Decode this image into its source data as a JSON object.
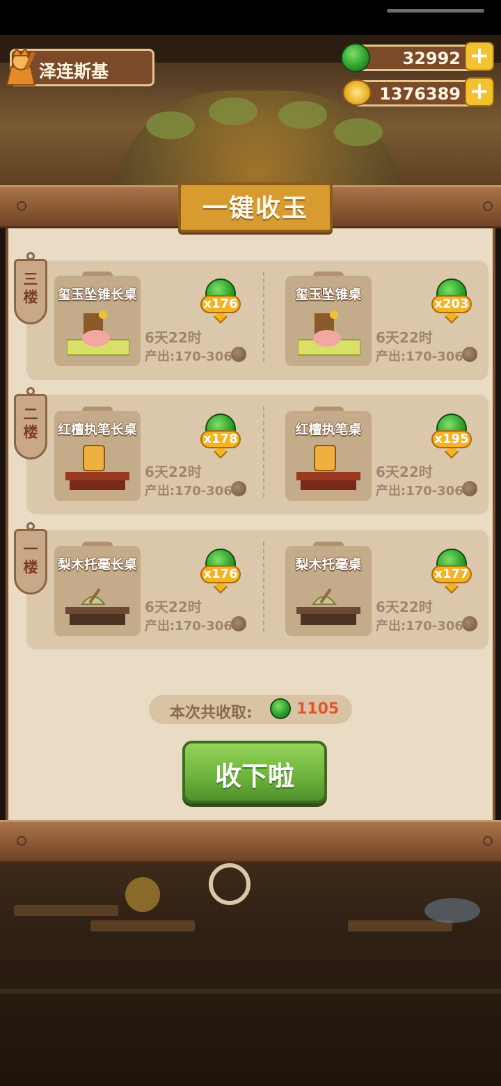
{
  "hud": {
    "player_name": "泽连斯基",
    "jade_amount": "32992",
    "coin_amount": "1376389",
    "plus_glyph": "+"
  },
  "panel": {
    "title": "一键收玉"
  },
  "floors": [
    {
      "label": "三楼",
      "desks": [
        {
          "name": "玺玉坠锥长桌",
          "count": "x176",
          "time": "6天22时",
          "output": "产出:170-306"
        },
        {
          "name": "玺玉坠锥桌",
          "count": "x203",
          "time": "6天22时",
          "output": "产出:170-306"
        }
      ]
    },
    {
      "label": "二楼",
      "desks": [
        {
          "name": "红檀执笔长桌",
          "count": "x178",
          "time": "6天22时",
          "output": "产出:170-306"
        },
        {
          "name": "红檀执笔桌",
          "count": "x195",
          "time": "6天22时",
          "output": "产出:170-306"
        }
      ]
    },
    {
      "label": "一楼",
      "desks": [
        {
          "name": "梨木托毫长桌",
          "count": "x176",
          "time": "6天22时",
          "output": "产出:170-306"
        },
        {
          "name": "梨木托毫桌",
          "count": "x177",
          "time": "6天22时",
          "output": "产出:170-306"
        }
      ]
    }
  ],
  "footer": {
    "total_label": "本次共收取:",
    "total_value": "1105",
    "collect_button": "收下啦"
  },
  "colors": {
    "accent_orange": "#f5b324",
    "jade_green": "#2fa02c",
    "button_green": "#6cb23a",
    "total_value_color": "#e0582a"
  }
}
